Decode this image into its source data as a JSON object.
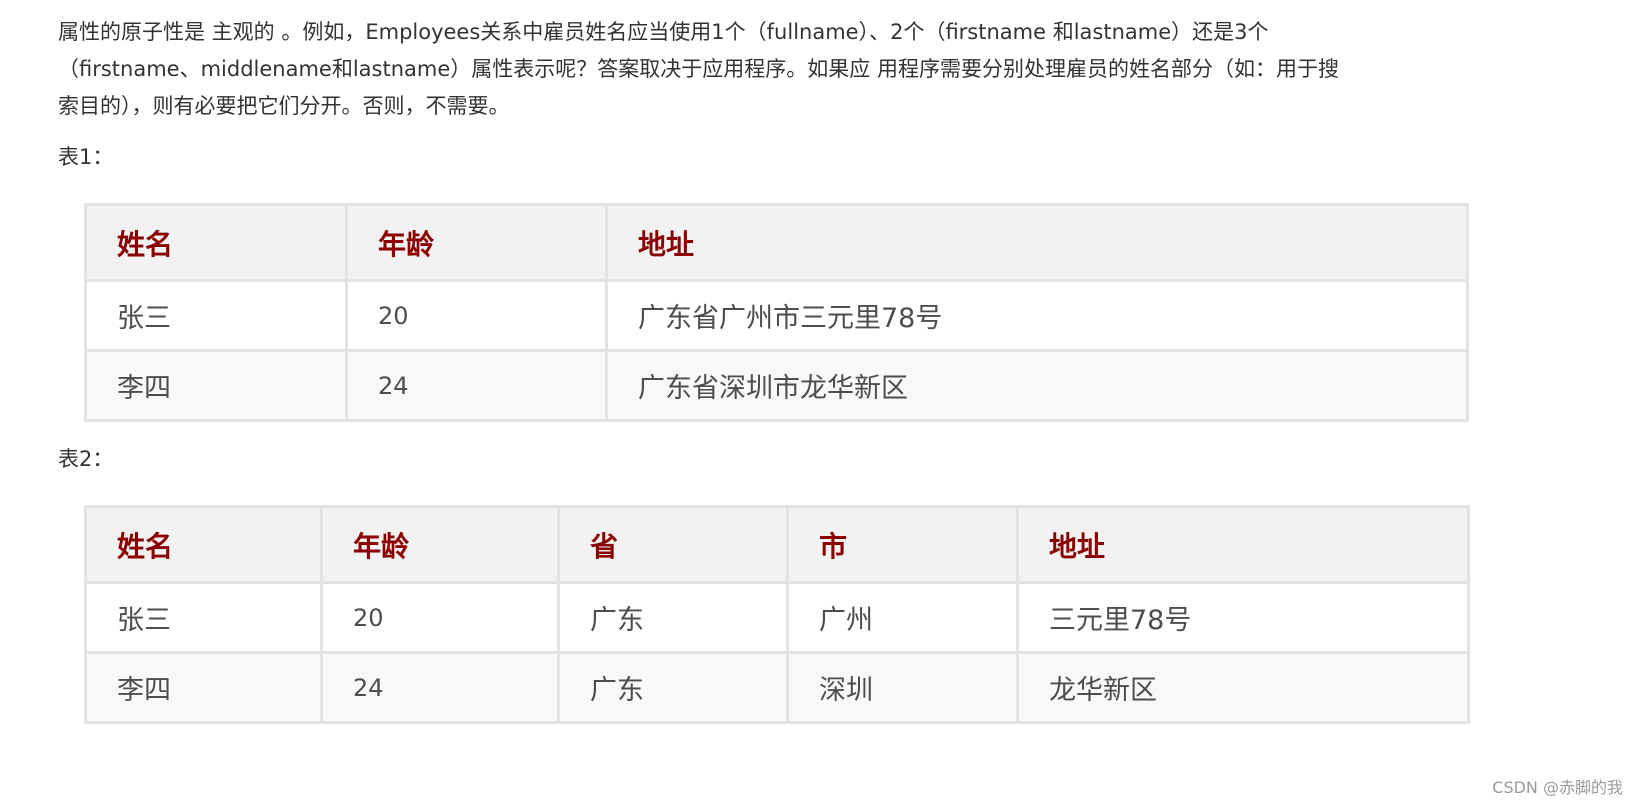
{
  "paragraph": {
    "lines": [
      "属性的原子性是 主观的 。例如，Employees关系中雇员姓名应当使用1个（fullname）、2个（firstname 和lastname）还是3个",
      "（firstname、middlename和lastname）属性表示呢？答案取决于应用程序。如果应 用程序需要分别处理雇员的姓名部分（如：用于搜",
      "索目的），则有必要把它们分开。否则，不需要。"
    ]
  },
  "table1": {
    "label": "表1：",
    "headers": [
      "姓名",
      "年龄",
      "地址"
    ],
    "rows": [
      [
        "张三",
        "20",
        "广东省广州市三元里78号"
      ],
      [
        "李四",
        "24",
        "广东省深圳市龙华新区"
      ]
    ]
  },
  "table2": {
    "label": "表2：",
    "headers": [
      "姓名",
      "年龄",
      "省",
      "市",
      "地址"
    ],
    "rows": [
      [
        "张三",
        "20",
        "广东",
        "广州",
        "三元里78号"
      ],
      [
        "李四",
        "24",
        "广东",
        "深圳",
        "龙华新区"
      ]
    ]
  },
  "watermark": "CSDN @赤脚的我",
  "colors": {
    "header_text": "#8b0000",
    "header_bg": "#f2f2f2",
    "border": "#e3e3e3"
  }
}
